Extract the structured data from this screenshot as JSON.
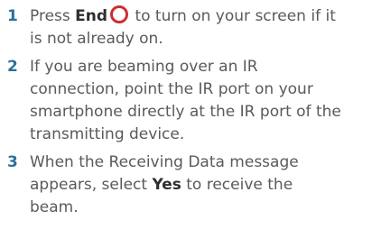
{
  "steps": [
    {
      "number": "1",
      "lines": [
        {
          "pre": "Press ",
          "bold": "End",
          "icon": "end-key-icon",
          "post": " to turn on your screen if it"
        },
        {
          "text": "is not already on."
        }
      ]
    },
    {
      "number": "2",
      "lines": [
        {
          "text": "If you are beaming over an IR"
        },
        {
          "text": "connection, point the IR port on your"
        },
        {
          "text": "smartphone directly at the IR port of the"
        },
        {
          "text": "transmitting device."
        }
      ]
    },
    {
      "number": "3",
      "lines": [
        {
          "text": "When the Receiving Data message"
        },
        {
          "pre": "appears, select ",
          "bold": "Yes",
          "post": " to receive the"
        },
        {
          "text": "beam."
        }
      ]
    }
  ],
  "colors": {
    "step_number": "#2e6f9e",
    "body_text": "#5a5a5a",
    "end_icon": "#cc2f2f"
  }
}
